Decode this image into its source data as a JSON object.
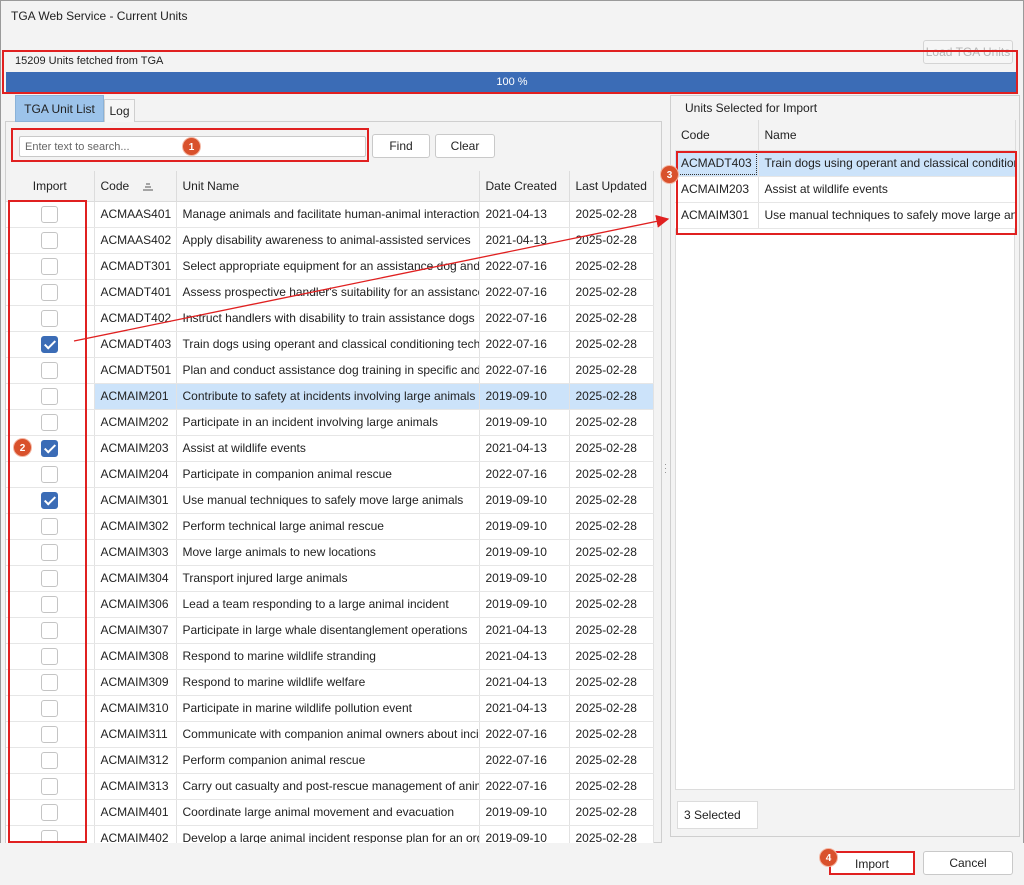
{
  "window": {
    "title": "TGA Web Service - Current Units"
  },
  "toolbar": {
    "load_label": "Load TGA Units"
  },
  "status": {
    "message": "15209 Units fetched from TGA",
    "progress_label": "100 %",
    "progress": 1.0
  },
  "tabs": [
    {
      "label": "TGA Unit List",
      "active": true
    },
    {
      "label": "Log",
      "active": false
    }
  ],
  "search": {
    "placeholder": "Enter text to search...",
    "find_label": "Find",
    "clear_label": "Clear"
  },
  "grid": {
    "columns": [
      "Import",
      "Code",
      "Unit Name",
      "Date Created",
      "Last Updated"
    ],
    "sort": {
      "column": "Code",
      "direction": "ascending"
    },
    "rows": [
      {
        "import": false,
        "code": "ACMAAS401",
        "name": "Manage animals and facilitate human-animal interaction in an animal-assisted service",
        "created": "2021-04-13",
        "updated": "2025-02-28"
      },
      {
        "import": false,
        "code": "ACMAAS402",
        "name": "Apply disability awareness to animal-assisted services",
        "created": "2021-04-13",
        "updated": "2025-02-28"
      },
      {
        "import": false,
        "code": "ACMADT301",
        "name": "Select appropriate equipment for an assistance dog and handler",
        "created": "2022-07-16",
        "updated": "2025-02-28"
      },
      {
        "import": false,
        "code": "ACMADT401",
        "name": "Assess prospective handler's suitability for an assistance dog",
        "created": "2022-07-16",
        "updated": "2025-02-28"
      },
      {
        "import": false,
        "code": "ACMADT402",
        "name": "Instruct handlers with disability to train assistance dogs",
        "created": "2022-07-16",
        "updated": "2025-02-28"
      },
      {
        "import": true,
        "code": "ACMADT403",
        "name": "Train dogs using operant and classical conditioning techniques",
        "created": "2022-07-16",
        "updated": "2025-02-28"
      },
      {
        "import": false,
        "code": "ACMADT501",
        "name": "Plan and conduct assistance dog training in specific and complex environments",
        "created": "2022-07-16",
        "updated": "2025-02-28"
      },
      {
        "import": false,
        "code": "ACMAIM201",
        "name": "Contribute to safety at incidents involving large animals",
        "created": "2019-09-10",
        "updated": "2025-02-28",
        "selected": true
      },
      {
        "import": false,
        "code": "ACMAIM202",
        "name": "Participate in an incident involving large animals",
        "created": "2019-09-10",
        "updated": "2025-02-28"
      },
      {
        "import": true,
        "code": "ACMAIM203",
        "name": "Assist at wildlife events",
        "created": "2021-04-13",
        "updated": "2025-02-28"
      },
      {
        "import": false,
        "code": "ACMAIM204",
        "name": "Participate in companion animal rescue",
        "created": "2022-07-16",
        "updated": "2025-02-28"
      },
      {
        "import": true,
        "code": "ACMAIM301",
        "name": "Use manual techniques to safely move large animals",
        "created": "2019-09-10",
        "updated": "2025-02-28"
      },
      {
        "import": false,
        "code": "ACMAIM302",
        "name": "Perform technical large animal rescue",
        "created": "2019-09-10",
        "updated": "2025-02-28"
      },
      {
        "import": false,
        "code": "ACMAIM303",
        "name": "Move large animals to new locations",
        "created": "2019-09-10",
        "updated": "2025-02-28"
      },
      {
        "import": false,
        "code": "ACMAIM304",
        "name": "Transport injured large animals",
        "created": "2019-09-10",
        "updated": "2025-02-28"
      },
      {
        "import": false,
        "code": "ACMAIM306",
        "name": "Lead a team responding to a large animal incident",
        "created": "2019-09-10",
        "updated": "2025-02-28"
      },
      {
        "import": false,
        "code": "ACMAIM307",
        "name": "Participate in large whale disentanglement operations",
        "created": "2021-04-13",
        "updated": "2025-02-28"
      },
      {
        "import": false,
        "code": "ACMAIM308",
        "name": "Respond to marine wildlife stranding",
        "created": "2021-04-13",
        "updated": "2025-02-28"
      },
      {
        "import": false,
        "code": "ACMAIM309",
        "name": "Respond to marine wildlife welfare",
        "created": "2021-04-13",
        "updated": "2025-02-28"
      },
      {
        "import": false,
        "code": "ACMAIM310",
        "name": "Participate in marine wildlife pollution event",
        "created": "2021-04-13",
        "updated": "2025-02-28"
      },
      {
        "import": false,
        "code": "ACMAIM311",
        "name": "Communicate with companion animal owners about incident management",
        "created": "2022-07-16",
        "updated": "2025-02-28"
      },
      {
        "import": false,
        "code": "ACMAIM312",
        "name": "Perform companion animal rescue",
        "created": "2022-07-16",
        "updated": "2025-02-28"
      },
      {
        "import": false,
        "code": "ACMAIM313",
        "name": "Carry out casualty and post-rescue management of animals",
        "created": "2022-07-16",
        "updated": "2025-02-28"
      },
      {
        "import": false,
        "code": "ACMAIM401",
        "name": "Coordinate large animal movement and evacuation",
        "created": "2019-09-10",
        "updated": "2025-02-28"
      },
      {
        "import": false,
        "code": "ACMAIM402",
        "name": "Develop a large animal incident response plan for an organisation",
        "created": "2019-09-10",
        "updated": "2025-02-28"
      }
    ]
  },
  "selected_panel": {
    "title": "Units Selected for Import",
    "columns": [
      "Code",
      "Name"
    ],
    "rows": [
      {
        "code": "ACMADT403",
        "name": "Train dogs using operant and classical conditioning techniques"
      },
      {
        "code": "ACMAIM203",
        "name": "Assist at wildlife events"
      },
      {
        "code": "ACMAIM301",
        "name": "Use manual techniques to safely move large animals"
      }
    ],
    "count_label": "3 Selected"
  },
  "footer": {
    "import_label": "Import",
    "cancel_label": "Cancel"
  },
  "annotations": {
    "badges": [
      "1",
      "2",
      "3",
      "4"
    ]
  },
  "colors": {
    "accent": "#3b6cb6",
    "highlight": "#e02020",
    "selection": "#cce3fa",
    "badge": "#d9512c"
  }
}
